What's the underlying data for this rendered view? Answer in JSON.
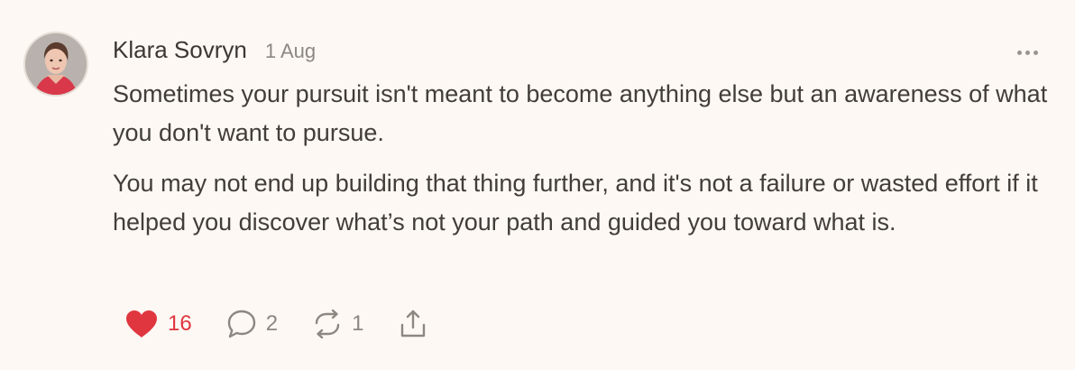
{
  "note": {
    "author": "Klara Sovryn",
    "date": "1 Aug",
    "paragraphs": [
      "Sometimes your pursuit isn't meant to become anything else but an awareness of what you don't want to pursue.",
      "You may not end up building that thing further, and it's not a failure or wasted effort if it helped you discover what’s not your path and guided you toward what is."
    ],
    "more_icon": "ellipsis-icon"
  },
  "actions": {
    "like": {
      "icon": "heart-icon",
      "count": "16",
      "liked": true,
      "color": "#e0363f"
    },
    "comment": {
      "icon": "speech-bubble-icon",
      "count": "2"
    },
    "restack": {
      "icon": "restack-arrows-icon",
      "count": "1"
    },
    "share": {
      "icon": "share-icon"
    }
  },
  "colors": {
    "background": "#fdf8f4",
    "text": "#433d39",
    "muted": "#8d8782",
    "accent": "#e0363f"
  }
}
